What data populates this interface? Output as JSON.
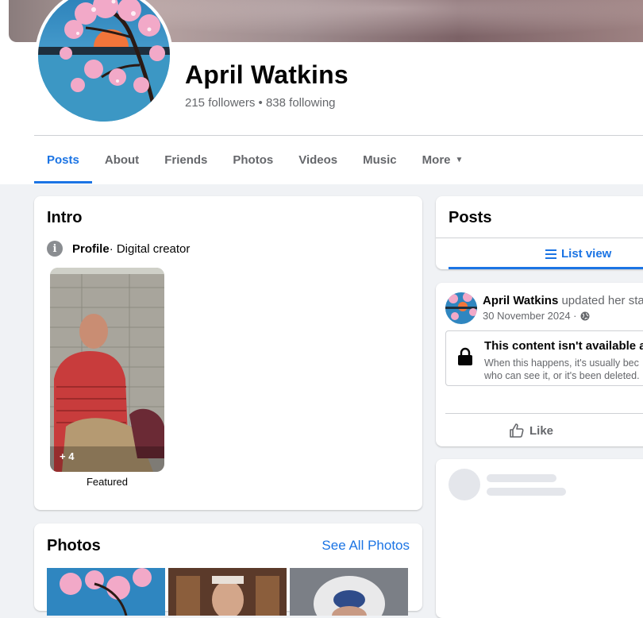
{
  "profile": {
    "name": "April Watkins",
    "followers_text": "215 followers • 838 following"
  },
  "tabs": [
    {
      "label": "Posts",
      "active": true
    },
    {
      "label": "About"
    },
    {
      "label": "Friends"
    },
    {
      "label": "Photos"
    },
    {
      "label": "Videos"
    },
    {
      "label": "Music"
    },
    {
      "label": "More"
    }
  ],
  "intro": {
    "title": "Intro",
    "category_label": "Profile",
    "category_value": " · Digital creator",
    "featured_count": "+ 4",
    "featured_label": "Featured"
  },
  "photos": {
    "title": "Photos",
    "see_all": "See All Photos"
  },
  "posts_panel": {
    "title": "Posts",
    "list_view": "List view"
  },
  "post": {
    "author": "April Watkins",
    "action": " updated her stat",
    "date": "30 November 2024 ·",
    "unavailable_title": "This content isn't available at",
    "unavailable_line1": "When this happens, it's usually bec",
    "unavailable_line2": "who can see it, or it's been deleted.",
    "like_label": "Like"
  },
  "colors": {
    "accent": "#1b74e4",
    "background": "#f0f2f5",
    "secondary_text": "#65676b"
  }
}
